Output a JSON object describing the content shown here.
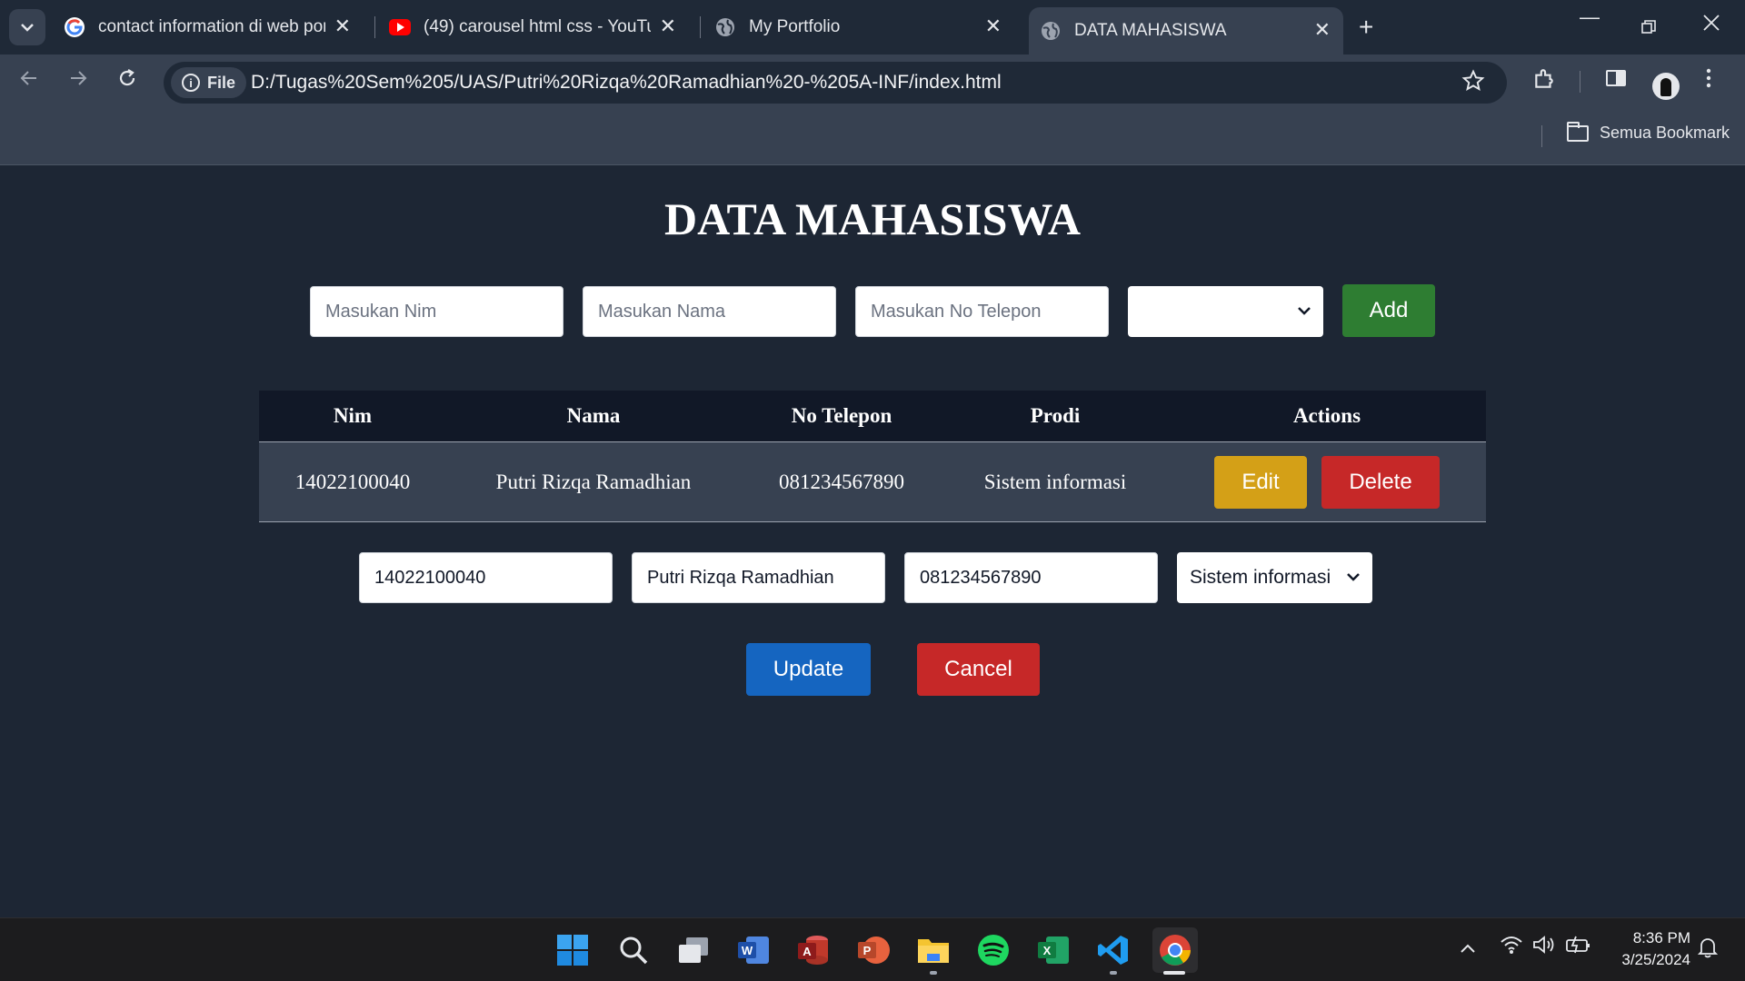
{
  "browser": {
    "tabs": [
      {
        "title": "contact information di web port",
        "icon": "google-icon"
      },
      {
        "title": "(49) carousel html css - YouTube",
        "icon": "youtube-icon"
      },
      {
        "title": "My Portfolio",
        "icon": "globe-icon"
      },
      {
        "title": "DATA MAHASISWA",
        "icon": "globe-icon",
        "active": true
      }
    ],
    "address": {
      "scheme_label": "File",
      "url": "D:/Tugas%20Sem%205/UAS/Putri%20Rizqa%20Ramadhian%20-%205A-INF/index.html"
    },
    "bookmarks_label": "Semua Bookmark"
  },
  "page": {
    "title": "DATA MAHASISWA",
    "add_form": {
      "nim_placeholder": "Masukan Nim",
      "nama_placeholder": "Masukan Nama",
      "telepon_placeholder": "Masukan No Telepon",
      "prodi_value": "",
      "add_label": "Add"
    },
    "table": {
      "headers": [
        "Nim",
        "Nama",
        "No Telepon",
        "Prodi",
        "Actions"
      ],
      "rows": [
        {
          "nim": "14022100040",
          "nama": "Putri Rizqa Ramadhian",
          "telepon": "081234567890",
          "prodi": "Sistem informasi",
          "edit_label": "Edit",
          "delete_label": "Delete"
        }
      ]
    },
    "edit_form": {
      "nim_value": "14022100040",
      "nama_value": "Putri Rizqa Ramadhian",
      "telepon_value": "081234567890",
      "prodi_value": "Sistem informasi",
      "update_label": "Update",
      "cancel_label": "Cancel"
    }
  },
  "colors": {
    "add": "#2e7d32",
    "edit": "#d4a017",
    "delete": "#c62828",
    "update": "#1565c0",
    "cancel": "#c62828"
  },
  "taskbar": {
    "apps": [
      "windows-start-icon",
      "search-icon",
      "task-view-icon",
      "word-icon",
      "access-icon",
      "powerpoint-icon",
      "file-explorer-icon",
      "spotify-icon",
      "excel-icon",
      "vscode-icon",
      "chrome-icon"
    ],
    "time": "8:36 PM",
    "date": "3/25/2024"
  }
}
